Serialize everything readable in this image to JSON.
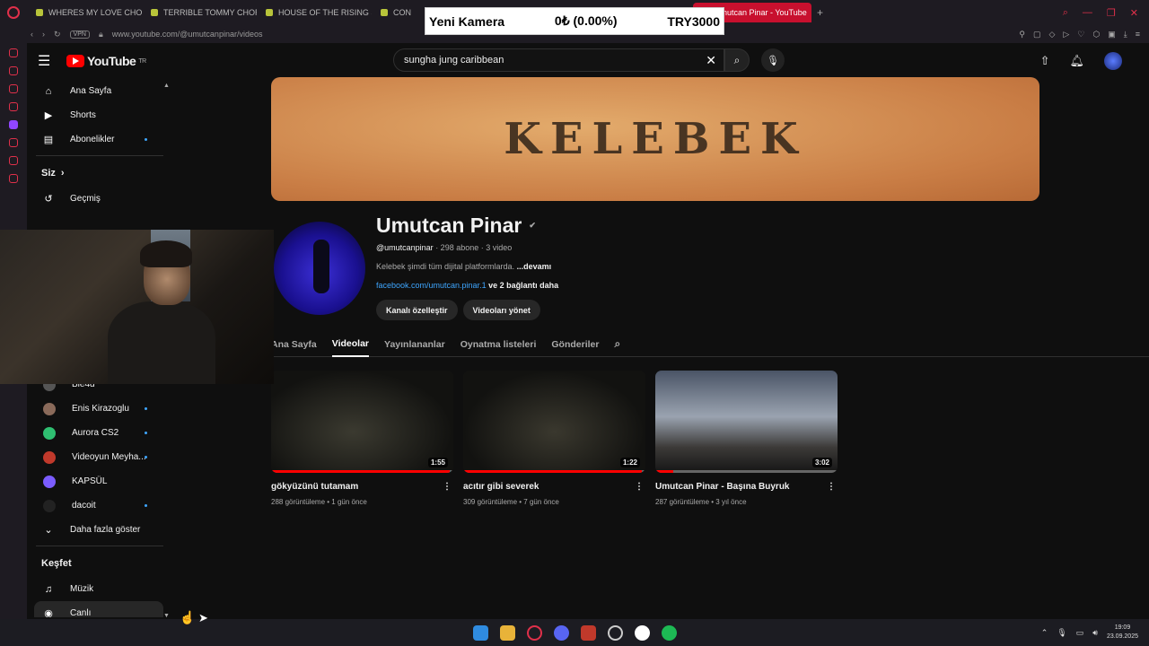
{
  "browser": {
    "tabs": [
      {
        "label": "WHERES MY LOVE CHOR"
      },
      {
        "label": "TERRIBLE TOMMY CHOR"
      },
      {
        "label": "HOUSE OF THE RISING S"
      },
      {
        "label": "CON"
      }
    ],
    "active_tab": "Umutcan Pinar - YouTube",
    "vpn_label": "VPN",
    "url": "www.youtube.com/@umutcanpinar/videos"
  },
  "overlay": {
    "name": "Yeni Kamera",
    "change": "0₺ (0.00%)",
    "price": "TRY3000"
  },
  "youtube": {
    "logo_text": "YouTube",
    "logo_region": "TR",
    "search_value": "sungha jung caribbean"
  },
  "sidebar": {
    "main": [
      {
        "label": "Ana Sayfa",
        "icon": "home-icon"
      },
      {
        "label": "Shorts",
        "icon": "shorts-icon"
      },
      {
        "label": "Abonelikler",
        "icon": "subscriptions-icon",
        "dot": true
      }
    ],
    "you_label": "Siz",
    "you_items": [
      {
        "label": "Geçmiş",
        "icon": "history-icon"
      }
    ],
    "channels": [
      {
        "label": "Ble4d",
        "color": "#555555",
        "dot": false
      },
      {
        "label": "Enis Kirazoglu",
        "color": "#8a6a5a",
        "dot": true
      },
      {
        "label": "Aurora CS2",
        "color": "#2fbf71",
        "dot": true
      },
      {
        "label": "Videoyun Meyha...",
        "color": "#c0392b",
        "dot": true
      },
      {
        "label": "KAPSÜL",
        "color": "#7b5cff",
        "dot": false
      },
      {
        "label": "dacoit",
        "color": "#222222",
        "dot": true
      }
    ],
    "show_more": "Daha fazla göster",
    "explore_label": "Keşfet",
    "explore": [
      {
        "label": "Müzik",
        "icon": "music-icon"
      },
      {
        "label": "Canlı",
        "icon": "live-icon"
      }
    ]
  },
  "channel": {
    "banner_text": "KELEBEK",
    "name": "Umutcan Pinar",
    "handle": "@umutcanpinar",
    "subs": "· 298 abone · 3 video",
    "description": "Kelebek şimdi tüm dijital platformlarda.",
    "more": "...devamı",
    "link": "facebook.com/umutcan.pinar.1",
    "link_more": "ve 2 bağlantı daha",
    "customize_btn": "Kanalı özelleştir",
    "manage_btn": "Videoları yönet",
    "tabs": [
      "Ana Sayfa",
      "Videolar",
      "Yayınlananlar",
      "Oynatma listeleri",
      "Gönderiler"
    ]
  },
  "videos": [
    {
      "title": "gökyüzünü tutamam",
      "meta": "288 görüntüleme • 1 gün önce",
      "duration": "1:55",
      "progress": 0.98
    },
    {
      "title": "acıtır gibi severek",
      "meta": "309 görüntüleme • 7 gün önce",
      "duration": "1:22",
      "progress": 0.98
    },
    {
      "title": "Umutcan Pinar - Başına Buyruk",
      "meta": "287 görüntüleme • 3 yıl önce",
      "duration": "3:02",
      "progress": 0.1
    }
  ],
  "taskbar": {
    "time": "19:09",
    "date": "23.09.2025"
  },
  "colors": {
    "accent": "#ff0000",
    "opera": "#e0304a",
    "link": "#3ea6ff"
  }
}
